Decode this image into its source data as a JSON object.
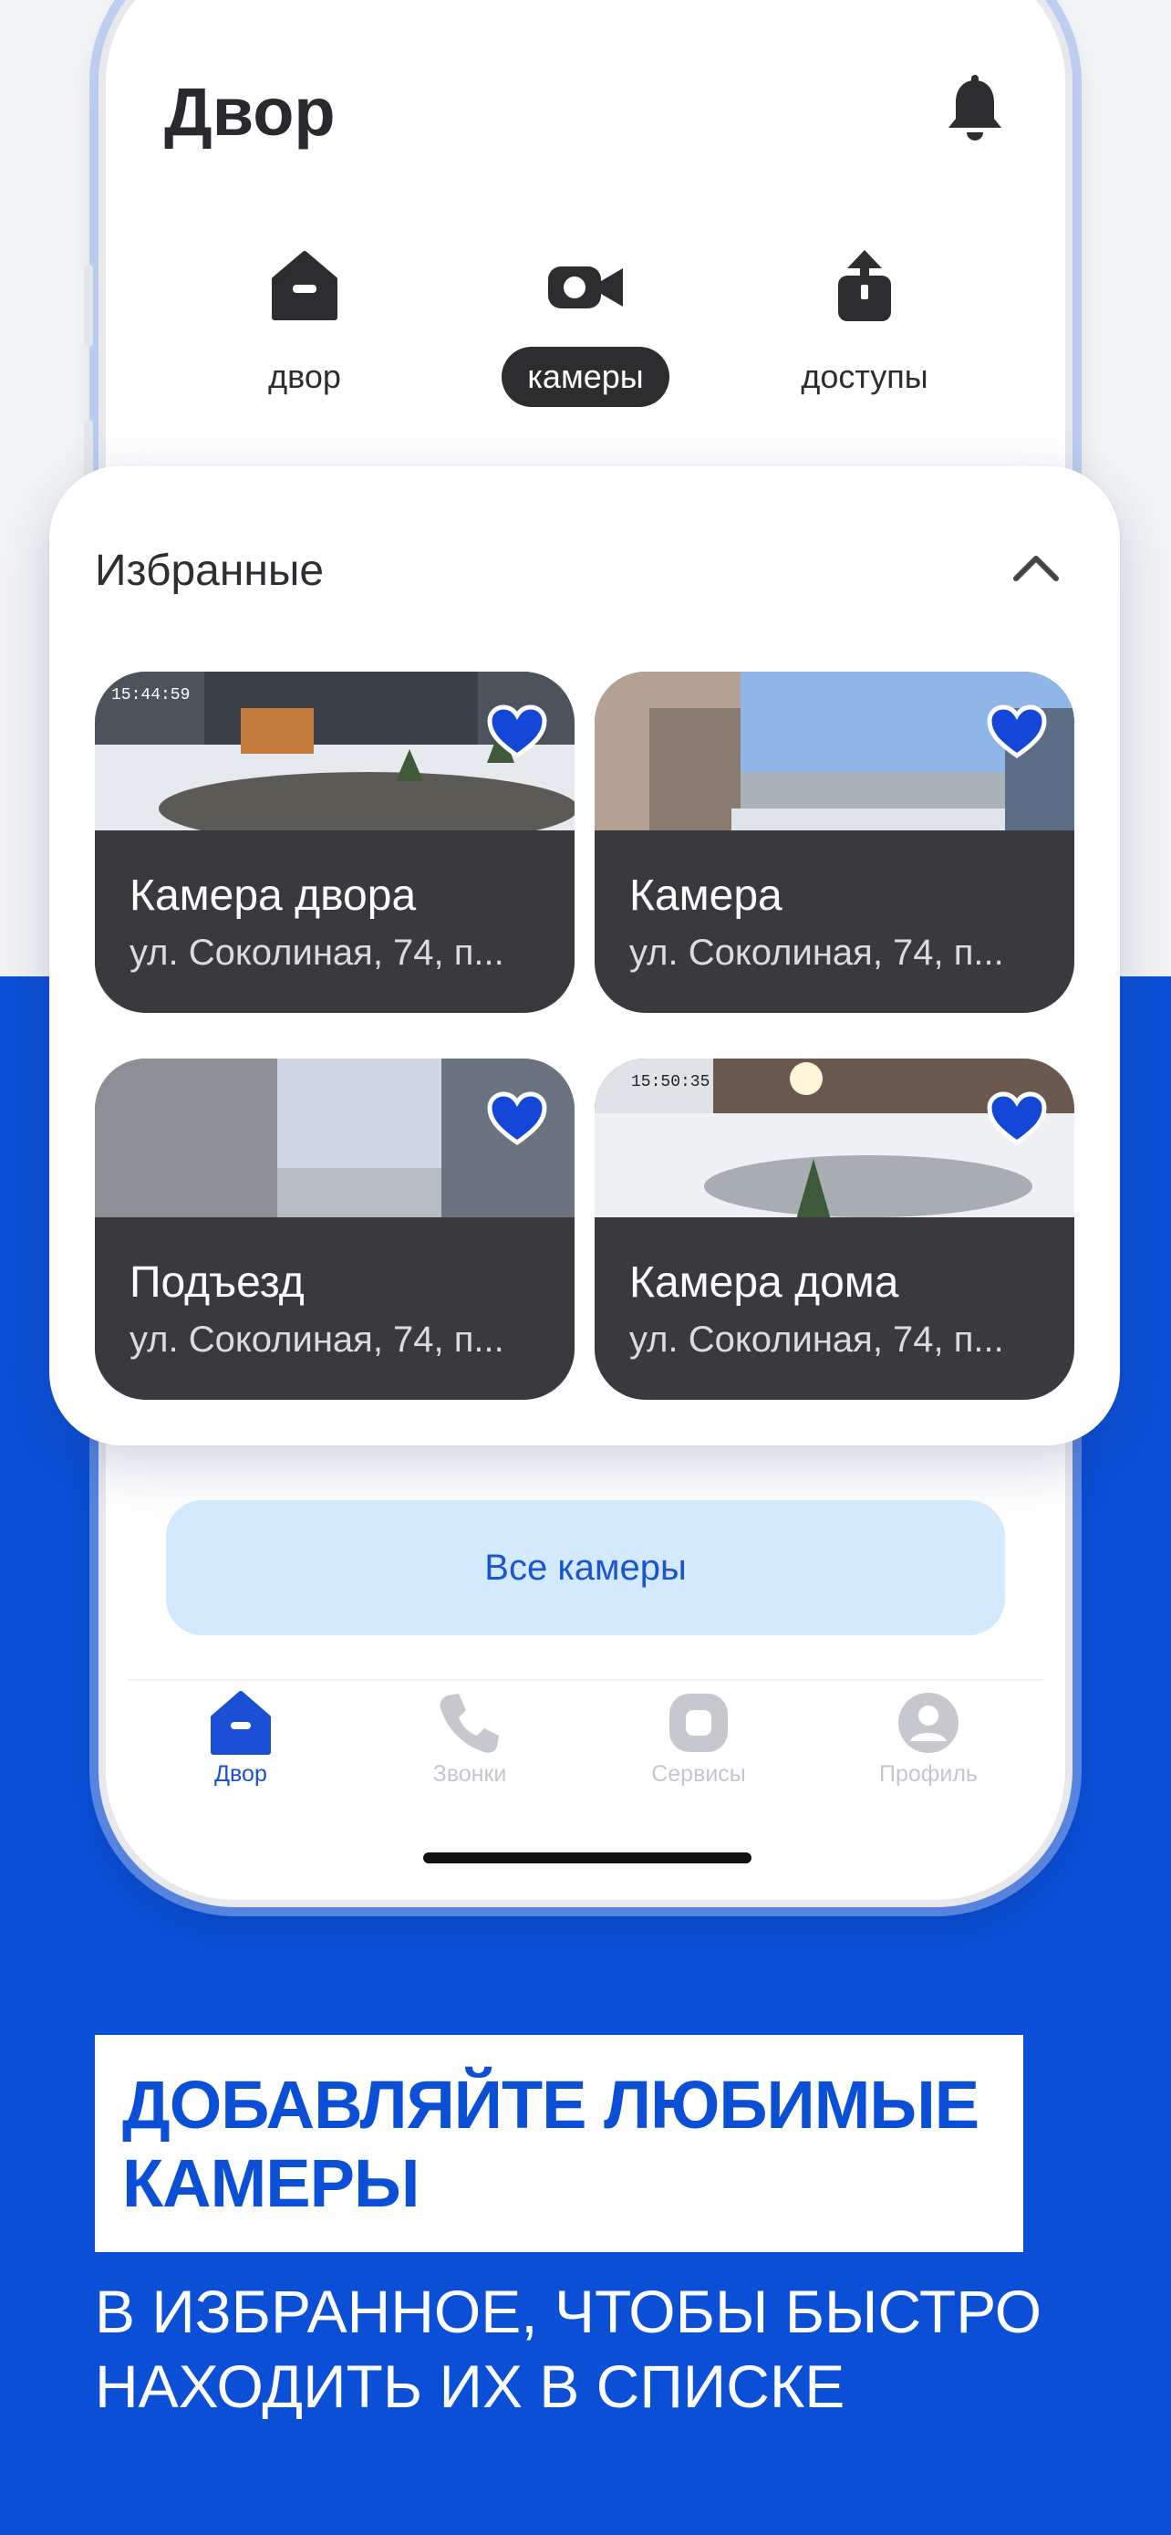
{
  "header": {
    "title": "Двор"
  },
  "tabs": [
    {
      "label": "двор",
      "icon": "house-icon"
    },
    {
      "label": "камеры",
      "icon": "video-camera-icon",
      "active": true
    },
    {
      "label": "доступы",
      "icon": "share-icon"
    }
  ],
  "favorites": {
    "title": "Избранные",
    "cameras": [
      {
        "name": "Камера двора",
        "address": "ул. Соколиная, 74, п...",
        "timestamp": "15:44:59",
        "favorite": true
      },
      {
        "name": "Камера",
        "address": "ул. Соколиная, 74, п...",
        "favorite": true
      },
      {
        "name": "Подъезд",
        "address": "ул. Соколиная, 74, п...",
        "favorite": true
      },
      {
        "name": "Камера дома",
        "address": "ул. Соколиная, 74, п...",
        "timestamp": "15:50:35",
        "favorite": true
      }
    ]
  },
  "all_cameras_label": "Все камеры",
  "nav": [
    {
      "label": "Двор",
      "icon": "house-icon",
      "active": true
    },
    {
      "label": "Звонки",
      "icon": "phone-icon"
    },
    {
      "label": "Сервисы",
      "icon": "services-icon"
    },
    {
      "label": "Профиль",
      "icon": "profile-icon"
    }
  ],
  "promo": {
    "headline_line1": "ДОБАВЛЯЙТЕ ЛЮБИМЫЕ",
    "headline_line2": "КАМЕРЫ",
    "sub_line1": "В ИЗБРАННОЕ, ЧТОБЫ БЫСТРО",
    "sub_line2": "НАХОДИТЬ ИХ В СПИСКЕ"
  },
  "colors": {
    "brand_blue": "#0a4fd6",
    "heart_blue": "#1446d8",
    "button_bg": "#d3e9fd"
  }
}
